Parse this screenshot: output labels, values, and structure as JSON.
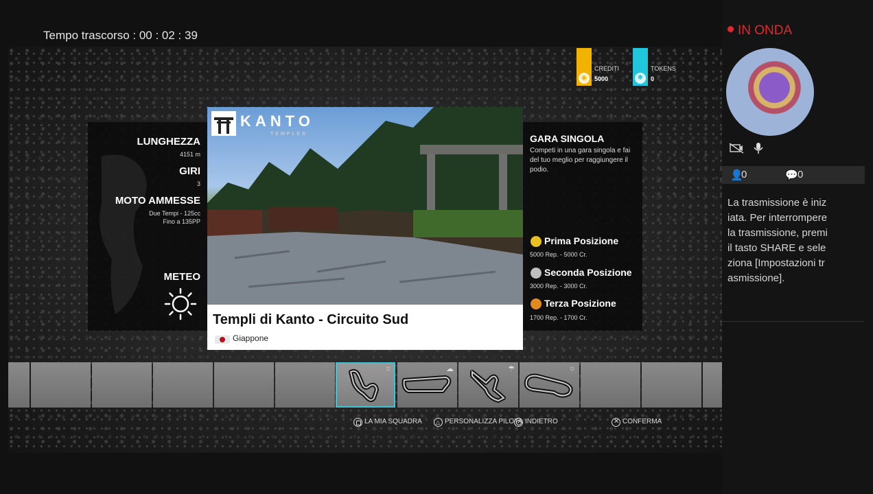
{
  "hud": {
    "elapsed": "Tempo trascorso : 00 : 02 : 39"
  },
  "currency": {
    "credits_label": "CREDITI",
    "credits_value": "5000",
    "tokens_label": "TOKENS",
    "tokens_value": "0",
    "credits_color": "#f2b200",
    "tokens_color": "#1fc6dc"
  },
  "track_info": {
    "length_label": "LUNGHEZZA",
    "length_value": "4151 m",
    "laps_label": "GIRI",
    "laps_value": "3",
    "bikes_label": "MOTO AMMESSE",
    "bikes_value_1": "Due Tempi - 125cc",
    "bikes_value_2": "Fino a 135PP",
    "weather_label": "METEO",
    "weather_icon": "sun-icon"
  },
  "card": {
    "logo_title": "KANTO",
    "logo_sub": "TEMPLES",
    "track_name": "Templi di Kanto - Circuito Sud",
    "country": "Giappone"
  },
  "race": {
    "title": "GARA SINGOLA",
    "description": "Competi in una gara singola e fai del tuo meglio per raggiungere il podio.",
    "positions": [
      {
        "label": "Prima Posizione",
        "reward": "5000 Rep. - 5000 Cr.",
        "color": "#e8c020"
      },
      {
        "label": "Seconda Posizione",
        "reward": "3000 Rep. - 3000 Cr.",
        "color": "#bfbfbf"
      },
      {
        "label": "Terza Posizione",
        "reward": "1700 Rep. - 1700 Cr.",
        "color": "#e08a20"
      }
    ]
  },
  "hints": {
    "team": "LA MIA SQUADRA",
    "rider": "PERSONALIZZA PILOTA",
    "back": "INDIETRO",
    "confirm": "CONFERMA"
  },
  "stream": {
    "status": "IN ONDA",
    "viewers": "0",
    "comments": "0",
    "message": "La trasmissione è iniziata. Per interrompere la trasmissione, premi il tasto SHARE e seleziona [Impostazioni trasmissione].",
    "accent": "#e0282e"
  }
}
